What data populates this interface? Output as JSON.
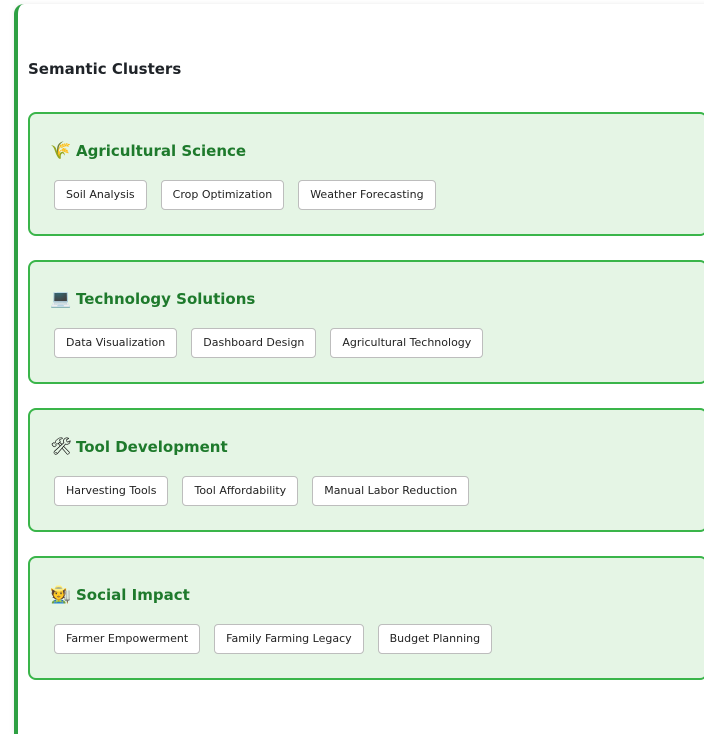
{
  "section": {
    "title": "Semantic Clusters"
  },
  "clusters": [
    {
      "icon": "🌾",
      "icon_name": "wheat-icon",
      "name": "Agricultural Science",
      "tags": [
        "Soil Analysis",
        "Crop Optimization",
        "Weather Forecasting"
      ]
    },
    {
      "icon": "💻",
      "icon_name": "laptop-icon",
      "name": "Technology Solutions",
      "tags": [
        "Data Visualization",
        "Dashboard Design",
        "Agricultural Technology"
      ]
    },
    {
      "icon": "🛠",
      "icon_name": "tools-icon",
      "name": "Tool Development",
      "tags": [
        "Harvesting Tools",
        "Tool Affordability",
        "Manual Labor Reduction"
      ]
    },
    {
      "icon": "🧑‍🌾",
      "icon_name": "farmer-icon",
      "name": "Social Impact",
      "tags": [
        "Farmer Empowerment",
        "Family Farming Legacy",
        "Budget Planning"
      ]
    }
  ],
  "colors": {
    "accent": "#2ea043",
    "cluster_bg": "#e5f5e5",
    "cluster_border": "#3ab54a",
    "cluster_title": "#1e7a2c"
  }
}
